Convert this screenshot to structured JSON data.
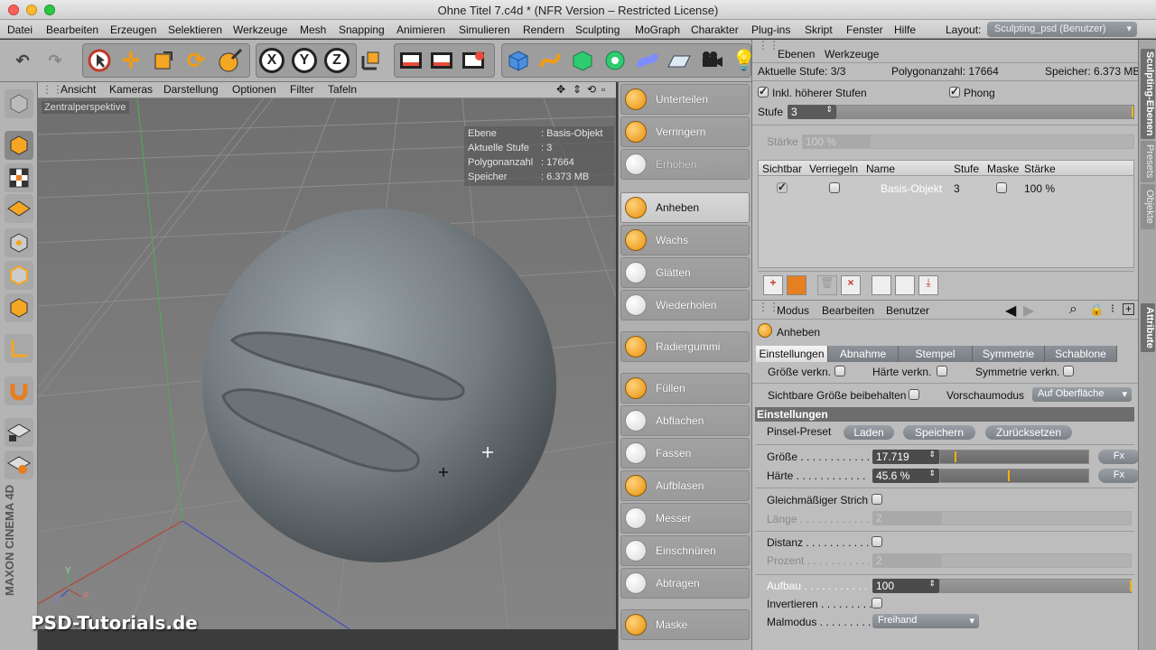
{
  "window": {
    "title": "Ohne Titel 7.c4d * (NFR Version – Restricted License)"
  },
  "menu": [
    "Datei",
    "Bearbeiten",
    "Erzeugen",
    "Selektieren",
    "Werkzeuge",
    "Mesh",
    "Snapping",
    "Animieren",
    "Simulieren",
    "Rendern",
    "Sculpting",
    "MoGraph",
    "Charakter",
    "Plug-ins",
    "Skript",
    "Fenster",
    "Hilfe"
  ],
  "layout": {
    "label": "Layout:",
    "value": "Sculpting_psd (Benutzer)"
  },
  "toolbar": {
    "x": "X",
    "y": "Y",
    "z": "Z"
  },
  "viewport": {
    "menu": [
      "Ansicht",
      "Kameras",
      "Darstellung",
      "Optionen",
      "Filter",
      "Tafeln"
    ],
    "camera": "Zentralperspektive",
    "hud": [
      {
        "k": "Ebene",
        "v": ": Basis-Objekt"
      },
      {
        "k": "Aktuelle Stufe",
        "v": ": 3"
      },
      {
        "k": "Polygonanzahl",
        "v": ": 17664"
      },
      {
        "k": "Speicher",
        "v": ": 6.373 MB"
      }
    ],
    "axis_y": "Y",
    "axis_x": "X",
    "axis_z": "Z",
    "maxon": "MAXON CINEMA 4D",
    "watermark": "PSD-Tutorials.de"
  },
  "sculpt_tools": [
    {
      "label": "Unterteilen",
      "state": "normal"
    },
    {
      "label": "Verringern",
      "state": "normal"
    },
    {
      "label": "Erhöhen",
      "state": "disabled"
    },
    {
      "label": "Anheben",
      "state": "active"
    },
    {
      "label": "Wachs",
      "state": "normal"
    },
    {
      "label": "Glätten",
      "state": "normal"
    },
    {
      "label": "Wiederholen",
      "state": "normal"
    },
    {
      "label": "Radiergummi",
      "state": "normal"
    },
    {
      "label": "Füllen",
      "state": "normal"
    },
    {
      "label": "Abflachen",
      "state": "normal"
    },
    {
      "label": "Fassen",
      "state": "normal"
    },
    {
      "label": "Aufblasen",
      "state": "normal"
    },
    {
      "label": "Messer",
      "state": "normal"
    },
    {
      "label": "Einschnüren",
      "state": "normal"
    },
    {
      "label": "Abtragen",
      "state": "normal"
    },
    {
      "label": "Maske",
      "state": "normal"
    }
  ],
  "layers": {
    "tabs": [
      "Ebenen",
      "Werkzeuge"
    ],
    "current_level": "Aktuelle Stufe: 3/3",
    "poly_count": "Polygonanzahl: 17664",
    "memory": "Speicher: 6.373 MB",
    "incl_higher": "Inkl. höherer Stufen",
    "phong": "Phong",
    "level_label": "Stufe",
    "level_value": "3",
    "strength_label": "Stärke",
    "strength_value": "100 %",
    "columns": [
      "Sichtbar",
      "Verriegeln",
      "Name",
      "Stufe",
      "Maske",
      "Stärke"
    ],
    "rows": [
      {
        "name": "Basis-Objekt",
        "level": "3",
        "strength": "100 %"
      }
    ]
  },
  "attributes": {
    "menu": [
      "Modus",
      "Bearbeiten",
      "Benutzer"
    ],
    "tool_name": "Anheben",
    "tabs": [
      "Einstellungen",
      "Abnahme",
      "Stempel",
      "Symmetrie",
      "Schablone"
    ],
    "size_link": "Größe verkn.",
    "hardness_link": "Härte verkn.",
    "sym_link": "Symmetrie verkn.",
    "keep_visible_size": "Sichtbare Größe beibehalten",
    "preview_mode_label": "Vorschaumodus",
    "preview_mode_value": "Auf Oberfläche",
    "section": "Einstellungen",
    "brush_preset": "Pinsel-Preset",
    "load": "Laden",
    "save": "Speichern",
    "reset": "Zurücksetzen",
    "size_label": "Größe . . . . . . . . . . . .",
    "size_value": "17.719",
    "size_level": 0.1,
    "hardness_label": "Härte . . . . . . . . . . . .",
    "hardness_value": "45.6 %",
    "hardness_level": 0.456,
    "fx": "Fx",
    "even_stroke": "Gleichmäßiger Strich",
    "length_label": "Länge . . . . . . . . . . . .",
    "length_value": "2",
    "distance_label": "Distanz . . . . . . . . . . .",
    "percent_label": "Prozent . . . . . . . . . . .",
    "percent_value": "2",
    "build_label": "Aufbau . . . . . . . . . . .",
    "build_value": "100",
    "invert_label": "Invertieren . . . . . . . . .",
    "paint_mode_label": "Malmodus . . . . . . . . .",
    "paint_mode_value": "Freihand"
  },
  "side_tabs": [
    "Sculpting-Ebenen",
    "Presets",
    "Objekte",
    "Attribute"
  ]
}
